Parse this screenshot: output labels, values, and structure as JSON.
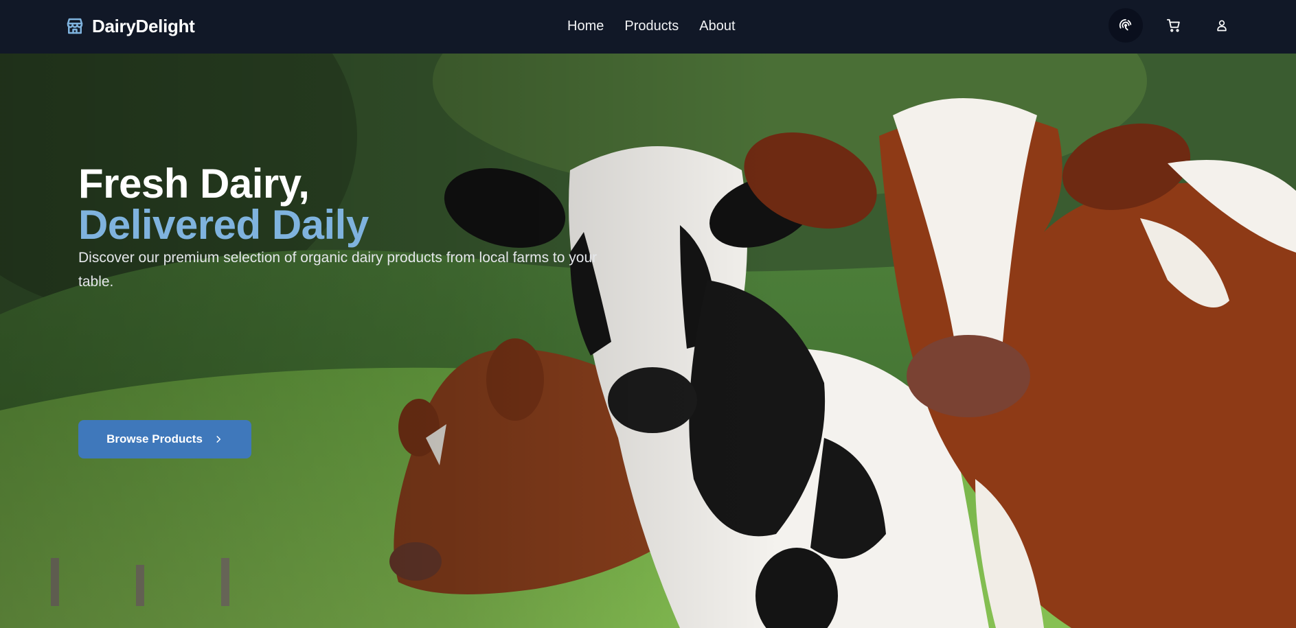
{
  "brand": {
    "name": "DairyDelight",
    "icon": "store-icon",
    "accent": "#7fb3de"
  },
  "nav": {
    "links": [
      "Home",
      "Products",
      "About"
    ]
  },
  "actions": {
    "theme": "theme-toggle-icon",
    "cart": "cart-icon",
    "user": "user-icon"
  },
  "hero": {
    "title_line1": "Fresh Dairy,",
    "title_line2": "Delivered Daily",
    "subtitle": "Discover our premium selection of organic dairy products from local farms to your table.",
    "cta_label": "Browse Products",
    "cta_color": "#3f78bb",
    "background": "cows-pasture-photo"
  }
}
